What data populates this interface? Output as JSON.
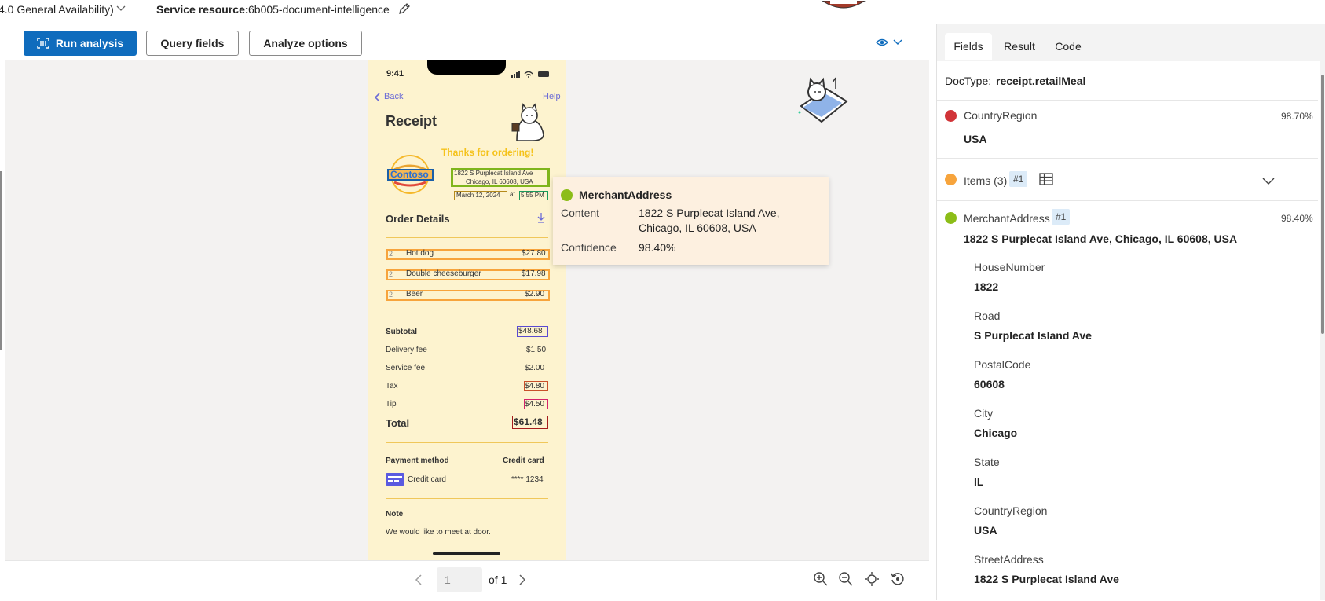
{
  "topbar": {
    "api_version": "4.0 General Availability)",
    "service_label": "Service resource:",
    "service_value": "6b005-document-intelligence"
  },
  "toolbar": {
    "run_label": "Run analysis",
    "query_label": "Query fields",
    "options_label": "Analyze options"
  },
  "pager": {
    "page_value": "1",
    "of_label": "of 1"
  },
  "receipt": {
    "time": "9:41",
    "back": "Back",
    "help": "Help",
    "title": "Receipt",
    "thanks": "Thanks for ordering!",
    "logo_text": "Contoso",
    "address_line1": "1822 S Purplecat Island Ave",
    "address_line2": "Chicago, IL 60608, USA",
    "date": "March 12, 2024",
    "at": "at",
    "time_ordered": "5:55 PM",
    "order_details": "Order Details",
    "items": [
      {
        "qty": "2",
        "name": "Hot dog",
        "price": "$27.80"
      },
      {
        "qty": "2",
        "name": "Double cheeseburger",
        "price": "$17.98"
      },
      {
        "qty": "2",
        "name": "Beer",
        "price": "$2.90"
      }
    ],
    "subtotal_label": "Subtotal",
    "subtotal": "$48.68",
    "delivery_label": "Delivery fee",
    "delivery": "$1.50",
    "service_label": "Service fee",
    "service": "$2.00",
    "tax_label": "Tax",
    "tax": "$4.80",
    "tip_label": "Tip",
    "tip": "$4.50",
    "total_label": "Total",
    "total": "$61.48",
    "payment_label": "Payment method",
    "payment_value": "Credit card",
    "card_label": "Credit card",
    "card_number": "**** 1234",
    "note_label": "Note",
    "note_text": "We would like to meet at door."
  },
  "tooltip": {
    "title": "MerchantAddress",
    "content_label": "Content",
    "content_line1": "1822 S Purplecat Island Ave,",
    "content_line2": "Chicago, IL 60608, USA",
    "confidence_label": "Confidence",
    "confidence_value": "98.40%"
  },
  "panel": {
    "tabs": [
      "Fields",
      "Result",
      "Code"
    ],
    "doctype_label": "DocType:",
    "doctype_value": "receipt.retailMeal",
    "country": {
      "label": "CountryRegion",
      "value": "USA",
      "pct": "98.70%",
      "color": "#d13438"
    },
    "items": {
      "label": "Items (3)",
      "badge": "#1",
      "color": "#f7a43c"
    },
    "merchant": {
      "label": "MerchantAddress",
      "badge": "#1",
      "pct": "98.40%",
      "value": "1822 S Purplecat Island Ave, Chicago, IL 60608, USA",
      "color": "#8cbd18"
    },
    "subfields": [
      {
        "label": "HouseNumber",
        "value": "1822"
      },
      {
        "label": "Road",
        "value": "S Purplecat Island Ave"
      },
      {
        "label": "PostalCode",
        "value": "60608"
      },
      {
        "label": "City",
        "value": "Chicago"
      },
      {
        "label": "State",
        "value": "IL"
      },
      {
        "label": "CountryRegion",
        "value": "USA"
      },
      {
        "label": "StreetAddress",
        "value": "1822 S Purplecat Island Ave"
      }
    ]
  },
  "colors": {
    "accent": "#0f6cbd",
    "receipt_bg": "#fdf3cf",
    "green_box": "#7fb51b",
    "orange_box": "#f7a43c"
  }
}
